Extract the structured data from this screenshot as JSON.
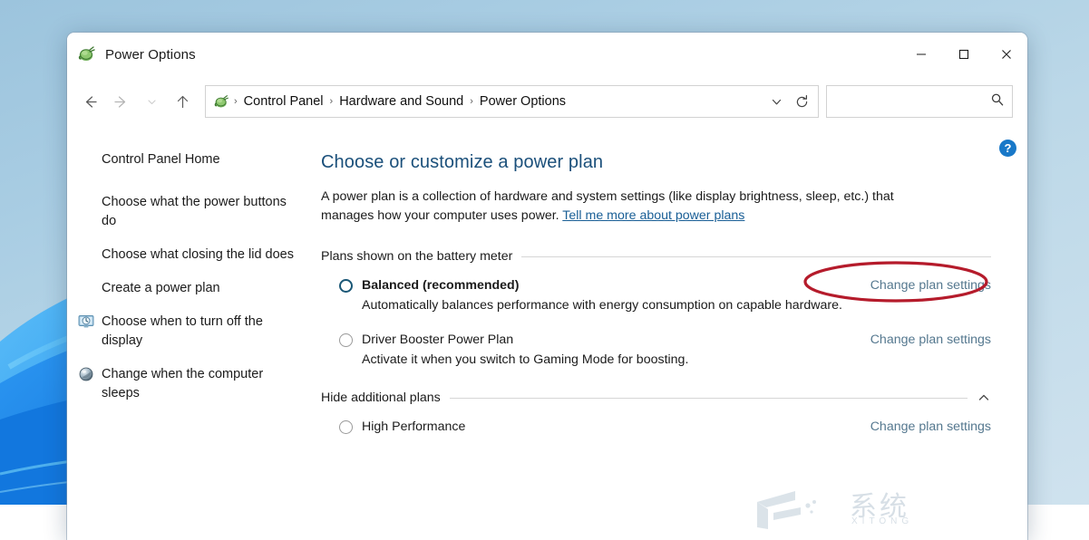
{
  "window": {
    "title": "Power Options",
    "app_icon": "power-plug-icon",
    "caption": {
      "minimize": "—",
      "maximize": "□",
      "close": "✕",
      "minimize_name": "minimize-button",
      "maximize_name": "maximize-button",
      "close_name": "close-button"
    }
  },
  "navbar": {
    "back_icon": "back-arrow-icon",
    "forward_icon": "forward-arrow-icon",
    "recent_icon": "chevron-down-icon",
    "up_icon": "up-arrow-icon",
    "breadcrumb": {
      "icon": "power-plug-icon",
      "items": [
        "Control Panel",
        "Hardware and Sound",
        "Power Options"
      ],
      "separator": "›"
    },
    "history_dropdown_icon": "chevron-down-icon",
    "refresh_icon": "refresh-icon",
    "search": {
      "value": "",
      "placeholder": "",
      "icon": "search-icon"
    }
  },
  "help": {
    "label": "?",
    "name": "help-button"
  },
  "sidebar": {
    "home": {
      "label": "Control Panel Home",
      "icon": null
    },
    "items": [
      {
        "label": "Choose what the power buttons do",
        "icon": null
      },
      {
        "label": "Choose what closing the lid does",
        "icon": null
      },
      {
        "label": "Create a power plan",
        "icon": null
      },
      {
        "label": "Choose when to turn off the display",
        "icon": "display-clock-icon"
      },
      {
        "label": "Change when the computer sleeps",
        "icon": "sleep-moon-icon"
      }
    ]
  },
  "main": {
    "title": "Choose or customize a power plan",
    "description_part1": "A power plan is a collection of hardware and system settings (like display brightness, sleep, etc.) that manages how your computer uses power. ",
    "description_link": "Tell me more about power plans",
    "groups": [
      {
        "header": "Plans shown on the battery meter",
        "chevron": null,
        "plans": [
          {
            "name": "Balanced (recommended)",
            "selected": true,
            "bold": true,
            "description": "Automatically balances performance with energy consumption on capable hardware.",
            "link": "Change plan settings",
            "highlighted": true
          },
          {
            "name": "Driver Booster Power Plan",
            "selected": false,
            "bold": false,
            "description": "Activate it when you switch to Gaming Mode for boosting.",
            "link": "Change plan settings",
            "highlighted": false
          }
        ]
      },
      {
        "header": "Hide additional plans",
        "chevron": "chevron-up-icon",
        "plans": [
          {
            "name": "High Performance",
            "selected": false,
            "bold": false,
            "description": "",
            "link": "Change plan settings",
            "highlighted": false
          }
        ]
      }
    ]
  },
  "annotation": {
    "shape": "ellipse",
    "color": "#b51b2b",
    "target": "Change plan settings"
  },
  "watermark": {
    "chinese": "系统",
    "english": "XITONG"
  },
  "colors": {
    "accent_blue": "#1878c8",
    "title_blue": "#1a4f7a",
    "link_blue": "#1a5f96",
    "plan_link": "#55788f",
    "annotation_red": "#b51b2b",
    "desktop_top": "#9cc4dd",
    "desktop_wave": "#1f8ff0"
  }
}
